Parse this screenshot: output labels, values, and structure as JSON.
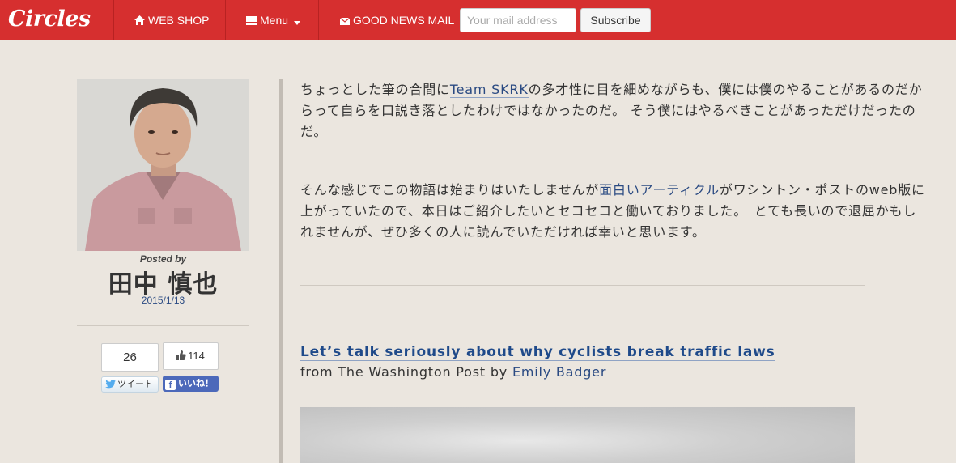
{
  "nav": {
    "brand": "Circles",
    "web_shop": "WEB SHOP",
    "menu": "Menu",
    "good_news_mail": "GOOD NEWS MAIL",
    "mail_placeholder": "Your mail address",
    "subscribe": "Subscribe",
    "icons": [
      "home-icon",
      "list-icon",
      "caret-down-icon",
      "envelope-icon"
    ]
  },
  "sidebar": {
    "posted_by": "Posted by",
    "author_name": "田中 慎也",
    "post_date": "2015/1/13",
    "tweet_count": "26",
    "tweet_label": "ツイート",
    "like_count": "114",
    "like_label": "いいね！"
  },
  "article": {
    "p1_before": "ちょっとした筆の合間に",
    "p1_link": "Team SKRK",
    "p1_after": "の多才性に目を細めながらも、僕には僕のやることがあるのだからって自らを口説き落としたわけではなかったのだ。 そう僕にはやるべきことがあっただけだったのだ。",
    "p2_before": "そんな感じでこの物語は始まりはいたしませんが",
    "p2_link": "面白いアーティクル",
    "p2_after": "がワシントン・ポストのweb版に上がっていたので、本日はご紹介したいとセコセコと働いておりました。　とても長いので退屈かもしれませんが、ぜひ多くの人に読んでいただければ幸いと思います。",
    "title": "Let’s talk seriously about why cyclists break traffic laws",
    "byline_prefix": "from The Washington Post by ",
    "byline_author": "Emily Badger"
  },
  "colors": {
    "navbar": "#d62f2f",
    "background": "#ebe6df",
    "link": "#2a4a82",
    "facebook": "#4c69ba"
  }
}
